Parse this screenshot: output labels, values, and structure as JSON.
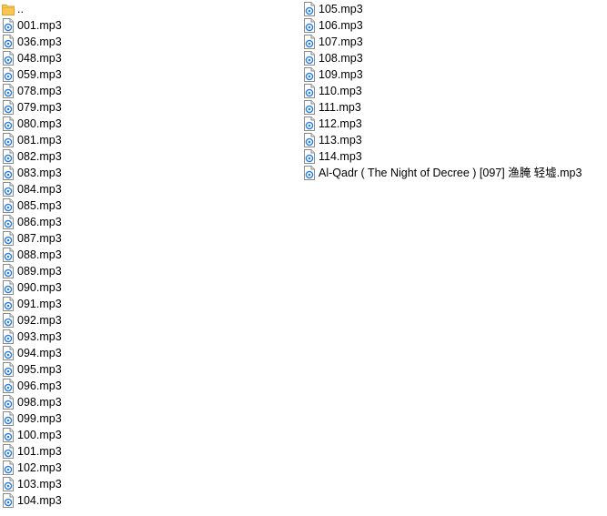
{
  "file_list": {
    "column_1": [
      {
        "name": "..",
        "icon": "folder-icon"
      },
      {
        "name": "001.mp3",
        "icon": "audio-file-icon"
      },
      {
        "name": "036.mp3",
        "icon": "audio-file-icon"
      },
      {
        "name": "048.mp3",
        "icon": "audio-file-icon"
      },
      {
        "name": "059.mp3",
        "icon": "audio-file-icon"
      },
      {
        "name": "078.mp3",
        "icon": "audio-file-icon"
      },
      {
        "name": "079.mp3",
        "icon": "audio-file-icon"
      },
      {
        "name": "080.mp3",
        "icon": "audio-file-icon"
      },
      {
        "name": "081.mp3",
        "icon": "audio-file-icon"
      },
      {
        "name": "082.mp3",
        "icon": "audio-file-icon"
      },
      {
        "name": "083.mp3",
        "icon": "audio-file-icon"
      },
      {
        "name": "084.mp3",
        "icon": "audio-file-icon"
      },
      {
        "name": "085.mp3",
        "icon": "audio-file-icon"
      },
      {
        "name": "086.mp3",
        "icon": "audio-file-icon"
      },
      {
        "name": "087.mp3",
        "icon": "audio-file-icon"
      },
      {
        "name": "088.mp3",
        "icon": "audio-file-icon"
      },
      {
        "name": "089.mp3",
        "icon": "audio-file-icon"
      },
      {
        "name": "090.mp3",
        "icon": "audio-file-icon"
      },
      {
        "name": "091.mp3",
        "icon": "audio-file-icon"
      },
      {
        "name": "092.mp3",
        "icon": "audio-file-icon"
      },
      {
        "name": "093.mp3",
        "icon": "audio-file-icon"
      },
      {
        "name": "094.mp3",
        "icon": "audio-file-icon"
      },
      {
        "name": "095.mp3",
        "icon": "audio-file-icon"
      },
      {
        "name": "096.mp3",
        "icon": "audio-file-icon"
      },
      {
        "name": "098.mp3",
        "icon": "audio-file-icon"
      },
      {
        "name": "099.mp3",
        "icon": "audio-file-icon"
      },
      {
        "name": "100.mp3",
        "icon": "audio-file-icon"
      },
      {
        "name": "101.mp3",
        "icon": "audio-file-icon"
      },
      {
        "name": "102.mp3",
        "icon": "audio-file-icon"
      },
      {
        "name": "103.mp3",
        "icon": "audio-file-icon"
      },
      {
        "name": "104.mp3",
        "icon": "audio-file-icon"
      }
    ],
    "column_2": [
      {
        "name": "105.mp3",
        "icon": "audio-file-icon"
      },
      {
        "name": "106.mp3",
        "icon": "audio-file-icon"
      },
      {
        "name": "107.mp3",
        "icon": "audio-file-icon"
      },
      {
        "name": "108.mp3",
        "icon": "audio-file-icon"
      },
      {
        "name": "109.mp3",
        "icon": "audio-file-icon"
      },
      {
        "name": "110.mp3",
        "icon": "audio-file-icon"
      },
      {
        "name": "111.mp3",
        "icon": "audio-file-icon"
      },
      {
        "name": "112.mp3",
        "icon": "audio-file-icon"
      },
      {
        "name": "113.mp3",
        "icon": "audio-file-icon"
      },
      {
        "name": "114.mp3",
        "icon": "audio-file-icon"
      },
      {
        "name": "Al-Qadr ( The Night of Decree ) [097] 渔腌 轻墟.mp3",
        "icon": "audio-file-icon"
      }
    ]
  },
  "colors": {
    "folder": "#f7c751",
    "audio_accent": "#2a7fd4"
  }
}
